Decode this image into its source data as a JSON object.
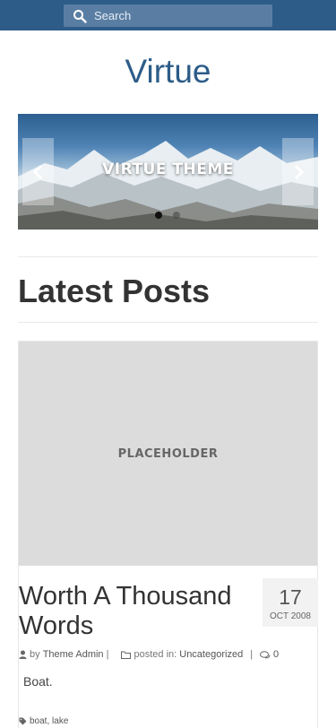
{
  "header": {
    "search_placeholder": "Search"
  },
  "site": {
    "title": "Virtue"
  },
  "slider": {
    "caption": "VIRTUE THEME",
    "slide_count": 2,
    "active_slide": 1
  },
  "section": {
    "title": "Latest Posts"
  },
  "post": {
    "image_label": "PLACEHOLDER",
    "title": "Worth A Thousand Words",
    "date_day": "17",
    "date_month": "OCT 2008",
    "meta_by": "by",
    "author": "Theme Admin",
    "separator": "|",
    "posted_in": "posted in:",
    "category": "Uncategorized",
    "comments": "0",
    "excerpt": "Boat.",
    "tags": [
      "boat",
      "lake"
    ],
    "tag_separator": ","
  },
  "colors": {
    "topbar": "#2d5c88",
    "accent": "#2d5c88",
    "search_bg": "#5a7ea3"
  },
  "icons": {
    "search": "search-icon",
    "prev": "chevron-left-icon",
    "next": "chevron-right-icon",
    "author": "user-icon",
    "category": "folder-icon",
    "comments": "comments-icon",
    "tags": "tag-icon"
  }
}
